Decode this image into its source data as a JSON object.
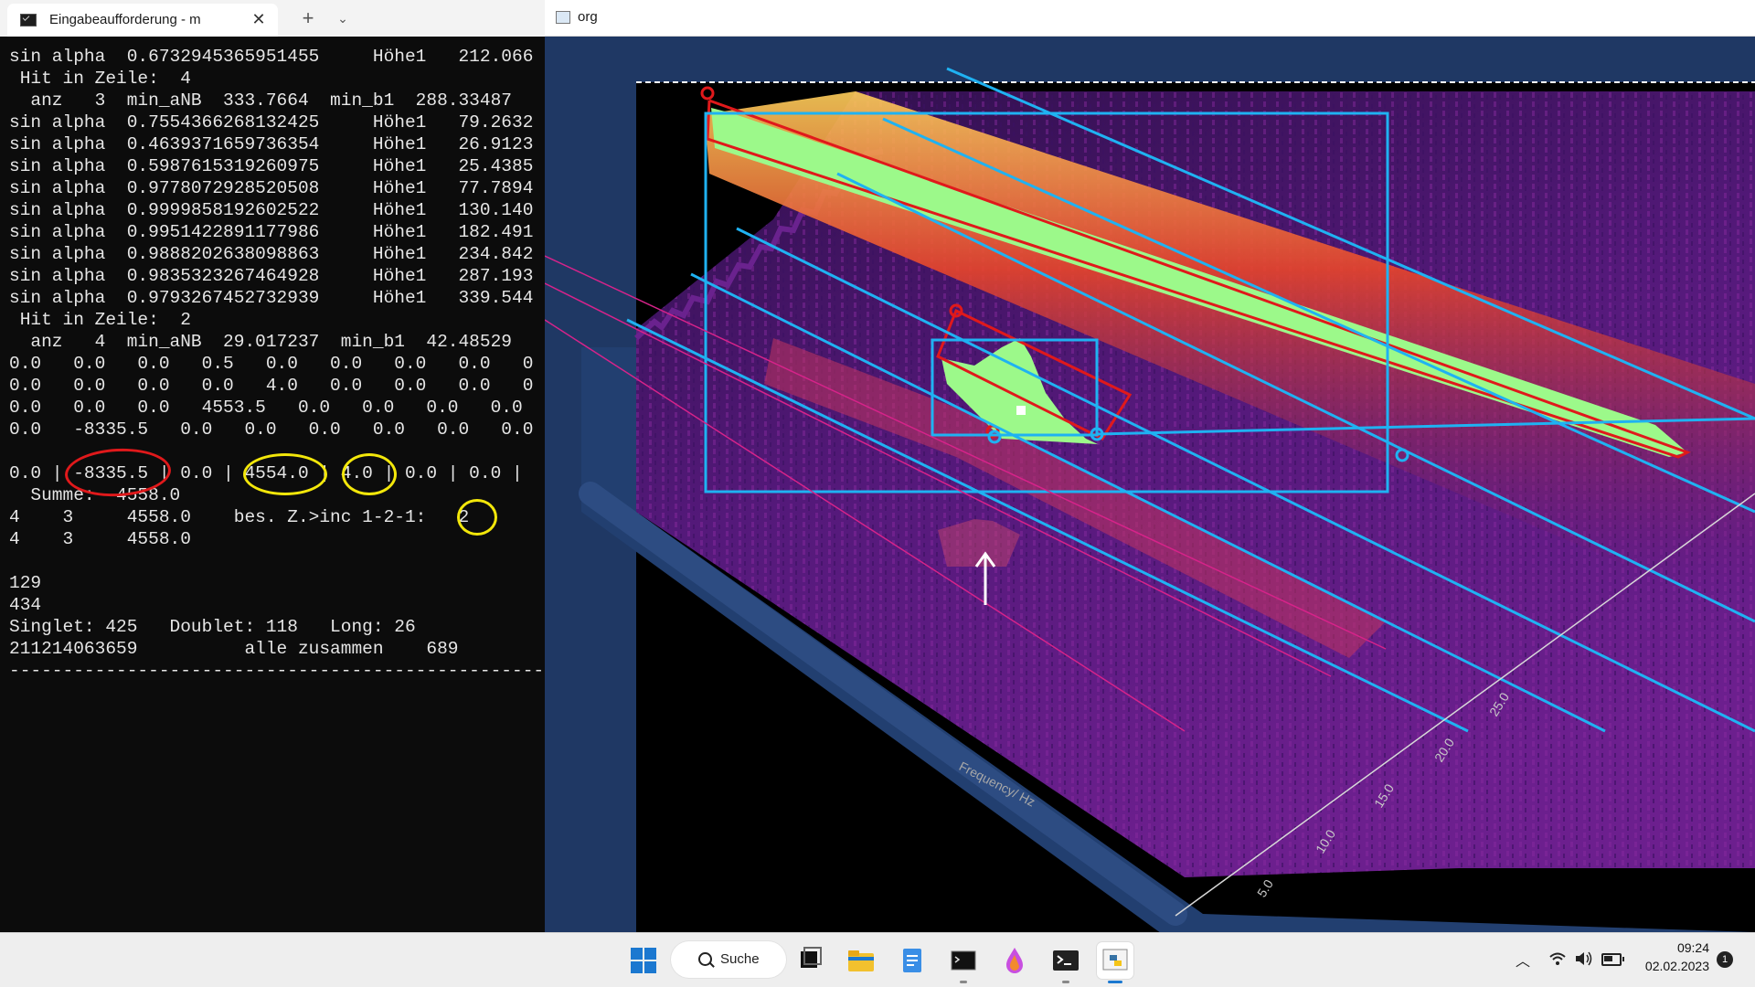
{
  "terminal": {
    "tab_title": "Eingabeaufforderung - m",
    "close_glyph": "✕",
    "new_tab_glyph": "+",
    "dropdown_glyph": "⌄",
    "lines": [
      "sin alpha  0.6732945365951455     Höhe1   212.066",
      " Hit in Zeile:  4",
      "  anz   3  min_aNB  333.7664  min_b1  288.33487",
      "sin alpha  0.7554366268132425     Höhe1   79.2632",
      "sin alpha  0.4639371659736354     Höhe1   26.9123",
      "sin alpha  0.5987615319260975     Höhe1   25.4385",
      "sin alpha  0.9778072928520508     Höhe1   77.7894",
      "sin alpha  0.9999858192602522     Höhe1   130.140",
      "sin alpha  0.9951422891177986     Höhe1   182.491",
      "sin alpha  0.9888202638098863     Höhe1   234.842",
      "sin alpha  0.9835323267464928     Höhe1   287.193",
      "sin alpha  0.9793267452732939     Höhe1   339.544",
      " Hit in Zeile:  2",
      "  anz   4  min_aNB  29.017237  min_b1  42.48529",
      "0.0   0.0   0.0   0.5   0.0   0.0   0.0   0.0   0",
      "0.0   0.0   0.0   0.0   4.0   0.0   0.0   0.0   0",
      "0.0   0.0   0.0   4553.5   0.0   0.0   0.0   0.0",
      "0.0   -8335.5   0.0   0.0   0.0   0.0   0.0   0.0",
      "",
      "0.0 | -8335.5 | 0.0 | 4554.0 | 4.0 | 0.0 | 0.0 |",
      "  Summe:  4558.0",
      "4    3     4558.0    bes. Z.>inc 1-2-1:   2",
      "4    3     4558.0",
      "",
      "129",
      "434",
      "Singlet: 425   Doublet: 118   Long: 26",
      "211214063659          alle zusammen    689",
      "------------------------------------------------------"
    ]
  },
  "viewer": {
    "title": "org",
    "axis_label": "Frequency/ Hz",
    "depth_ticks": [
      "5.0",
      "10.0",
      "15.0",
      "20.0",
      "25.0"
    ]
  },
  "colors": {
    "accent_cyan": "#1fb2f2",
    "annotation_red": "#e0191b",
    "highlight_yellow": "#f3e70a",
    "ridge_green": "#9cf98a"
  },
  "taskbar": {
    "search_label": "Suche",
    "chevron_glyph": "︿",
    "time": "09:24",
    "date": "02.02.2023",
    "notifications": "1"
  }
}
